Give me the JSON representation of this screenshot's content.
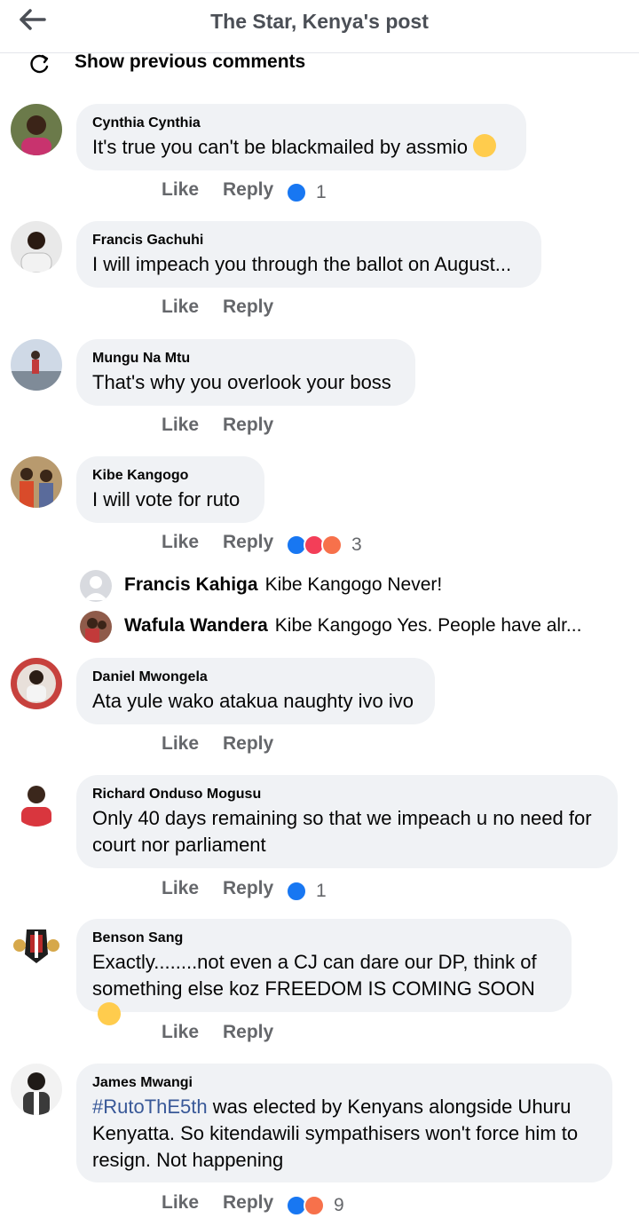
{
  "header": {
    "title": "The Star, Kenya's post",
    "back_icon": "arrow-left-icon"
  },
  "prev_comments": {
    "label": "Show previous comments",
    "icon": "refresh-icon"
  },
  "actions": {
    "like": "Like",
    "reply": "Reply"
  },
  "comments": [
    {
      "author": "Cynthia Cynthia",
      "text": "It's true you can't be blackmailed by assmio",
      "emoji": "thinking-face",
      "reactions": [
        "like"
      ],
      "count": "1"
    },
    {
      "author": "Francis Gachuhi",
      "text": "I will impeach you through the ballot on August...",
      "reactions": [],
      "count": ""
    },
    {
      "author": "Mungu Na Mtu",
      "text": "That's why you overlook your boss",
      "reactions": [],
      "count": ""
    },
    {
      "author": "Kibe Kangogo",
      "text": "I will vote for ruto",
      "reactions": [
        "like",
        "love",
        "angry"
      ],
      "count": "3"
    },
    {
      "author": "Daniel Mwongela",
      "text": "Ata yule wako atakua naughty ivo ivo",
      "reactions": [],
      "count": ""
    },
    {
      "author": "Richard Onduso Mogusu",
      "text": "Only 40 days remaining so that we impeach u no need for court nor parliament",
      "reactions": [
        "like"
      ],
      "count": "1"
    },
    {
      "author": "Benson Sang",
      "text": "Exactly........not even a CJ can dare our DP, think of something else koz FREEDOM IS COMING SOON",
      "emoji": "raised-fist",
      "reactions": [],
      "count": ""
    },
    {
      "author": "James Mwangi",
      "hashtag": "#RutoThE5th",
      "text": "was elected by Kenyans alongside Uhuru Kenyatta. So kitendawili sympathisers won't force him to resign. Not happening",
      "reactions": [
        "like",
        "angry"
      ],
      "count": "9"
    }
  ],
  "replies": [
    {
      "name": "Francis Kahiga",
      "text": "Kibe Kangogo Never!"
    },
    {
      "name": "Wafula Wandera",
      "text": "Kibe Kangogo Yes. People have alr..."
    }
  ],
  "colors": {
    "bubble": "#f0f2f5",
    "muted": "#65676b",
    "like_blue": "#1877f2",
    "love_red": "#f33e58",
    "angry_orange": "#f7714b",
    "hashtag": "#385898"
  }
}
